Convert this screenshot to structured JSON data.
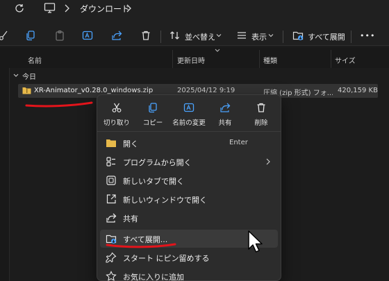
{
  "address": {
    "breadcrumb": "ダウンロード"
  },
  "toolbar": {
    "sort_label": "並べ替え",
    "view_label": "表示",
    "extract_all_label": "すべて展開",
    "more_label": "•••"
  },
  "columns": {
    "name": "名前",
    "modified": "更新日時",
    "type": "種類",
    "size": "サイズ"
  },
  "group": {
    "label": "今日"
  },
  "file": {
    "name": "XR-Animator_v0.28.0_windows.zip",
    "modified": "2025/04/12 9:19",
    "type": "圧縮 (zip 形式) フォ...",
    "size": "420,159 KB"
  },
  "context_menu": {
    "actions": [
      {
        "label": "切り取り",
        "icon": "scissors-icon"
      },
      {
        "label": "コピー",
        "icon": "copy-icon"
      },
      {
        "label": "名前の変更",
        "icon": "rename-icon"
      },
      {
        "label": "共有",
        "icon": "share-icon"
      },
      {
        "label": "削除",
        "icon": "trash-icon"
      }
    ],
    "items": [
      {
        "label": "開く",
        "shortcut": "Enter",
        "icon": "folder-icon"
      },
      {
        "label": "プログラムから開く",
        "icon": "open-with-icon"
      },
      {
        "label": "新しいタブで開く",
        "icon": "new-tab-icon"
      },
      {
        "label": "新しいウィンドウで開く",
        "icon": "new-window-icon"
      },
      {
        "label": "共有",
        "icon": "share-icon"
      },
      {
        "label": "すべて展開...",
        "icon": "extract-icon"
      },
      {
        "label": "スタート にピン留めする",
        "icon": "pin-icon"
      },
      {
        "label": "お気に入りに追加",
        "icon": "star-icon"
      }
    ]
  },
  "colors": {
    "folder": "#e7b94a",
    "annotation": "#e3141b",
    "accent": "#4aa3ff"
  }
}
